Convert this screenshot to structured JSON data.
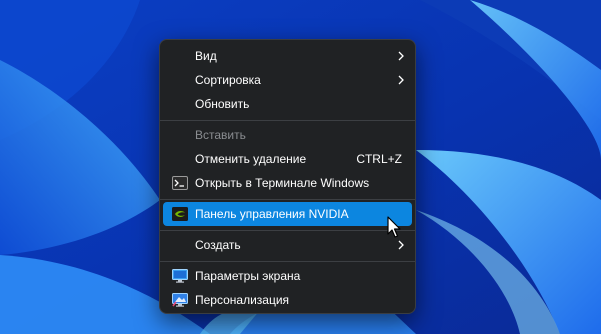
{
  "context_menu": {
    "items": [
      {
        "label": "Вид",
        "submenu": true
      },
      {
        "label": "Сортировка",
        "submenu": true
      },
      {
        "label": "Обновить"
      },
      {
        "label": "Вставить",
        "disabled": true
      },
      {
        "label": "Отменить удаление",
        "shortcut": "CTRL+Z"
      },
      {
        "label": "Открыть в Терминале Windows",
        "icon": "terminal-icon"
      },
      {
        "label": "Панель управления NVIDIA",
        "icon": "nvidia-icon",
        "highlighted": true
      },
      {
        "label": "Создать",
        "submenu": true
      },
      {
        "label": "Параметры экрана",
        "icon": "display-icon"
      },
      {
        "label": "Персонализация",
        "icon": "personalize-icon"
      }
    ]
  },
  "colors": {
    "menu_background": "#202224",
    "highlight": "#0c86e0",
    "wallpaper_dark": "#0a2fa8",
    "wallpaper_light": "#3aa8ff"
  }
}
